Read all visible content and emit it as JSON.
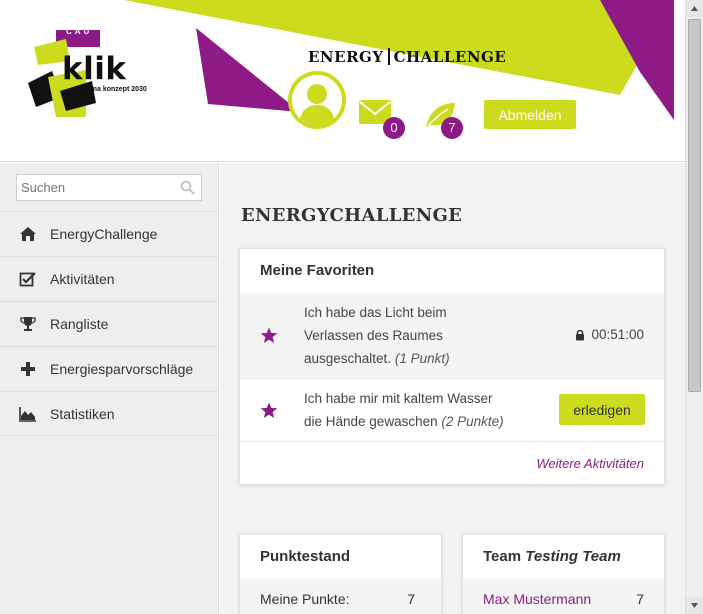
{
  "colors": {
    "accent": "#cddb1f",
    "purple": "#8e1b85",
    "dark": "#111111"
  },
  "logo": {
    "top": "CAU",
    "name": "klik",
    "sub": "klima konzept 2030"
  },
  "header": {
    "brand_left": "ENERGY",
    "brand_right": "CHALLENGE",
    "messages_count": "0",
    "leaf_count": "7",
    "logout_label": "Abmelden"
  },
  "sidebar": {
    "search_placeholder": "Suchen",
    "items": [
      {
        "label": "EnergyChallenge",
        "icon": "home-icon"
      },
      {
        "label": "Aktivitäten",
        "icon": "checkbox-icon"
      },
      {
        "label": "Rangliste",
        "icon": "trophy-icon"
      },
      {
        "label": "Energiesparvorschläge",
        "icon": "plus-icon"
      },
      {
        "label": "Statistiken",
        "icon": "area-chart-icon"
      }
    ]
  },
  "main": {
    "title": "ENERGYCHALLENGE",
    "favorites": {
      "title": "Meine Favoriten",
      "items": [
        {
          "line1": "Ich habe das Licht beim",
          "line2": "Verlassen des Raumes",
          "line3": "ausgeschaltet.",
          "points": "(1 Punkt)",
          "timer": "00:51:00"
        },
        {
          "line1": "Ich habe mir mit kaltem Wasser",
          "line2": "die Hände gewaschen",
          "points": "(2 Punkte)",
          "action": "erledigen"
        }
      ],
      "more_link": "Weitere Aktivitäten"
    },
    "points": {
      "title": "Punktestand",
      "label": "Meine Punkte:",
      "value": "7"
    },
    "team": {
      "title_prefix": "Team",
      "title_name": "Testing Team",
      "member": "Max Mustermann",
      "value": "7"
    }
  }
}
